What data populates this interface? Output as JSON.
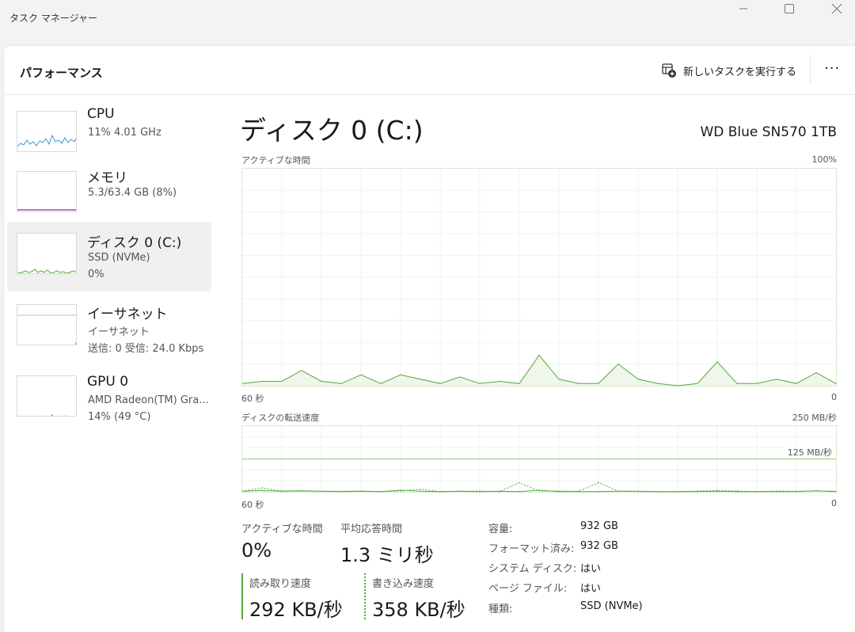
{
  "window": {
    "title": "タスク マネージャー",
    "minimize_glyph": "—",
    "maximize_glyph": "☐",
    "close_glyph": "✕"
  },
  "header": {
    "title": "パフォーマンス",
    "new_task_label": "新しいタスクを実行する",
    "new_task_icon": "new-task-icon",
    "more_label": "···"
  },
  "colors": {
    "cpu": "#3b9bd4",
    "memory": "#a43fb6",
    "disk": "#54a83e",
    "ethernet": "#d0752a",
    "gpu": "#3b9bd4"
  },
  "sidebar": {
    "items": [
      {
        "name": "CPU",
        "line1": "11%  4.01 GHz",
        "line2": ""
      },
      {
        "name": "メモリ",
        "line1": "5.3/63.4 GB (8%)",
        "line2": ""
      },
      {
        "name": "ディスク 0 (C:)",
        "line1": "SSD (NVMe)",
        "line2": "0%"
      },
      {
        "name": "イーサネット",
        "line1": "イーサネット",
        "line2": "送信: 0  受信: 24.0 Kbps"
      },
      {
        "name": "GPU 0",
        "line1": "AMD Radeon(TM) Gra...",
        "line2": "14%  (49 °C)"
      }
    ]
  },
  "main": {
    "title": "ディスク 0 (C:)",
    "model": "WD Blue SN570 1TB",
    "active_graph": {
      "label": "アクティブな時間",
      "max_label": "100%",
      "time_label": "60 秒",
      "min_label": "0"
    },
    "transfer_graph": {
      "label": "ディスクの転送速度",
      "max_label": "250 MB/秒",
      "mid_label": "125 MB/秒",
      "time_label": "60 秒",
      "min_label": "0"
    },
    "stats": {
      "active_time_label": "アクティブな時間",
      "active_time_value": "0%",
      "avg_response_label": "平均応答時間",
      "avg_response_value": "1.3 ミリ秒",
      "read_label": "読み取り速度",
      "read_value": "292 KB/秒",
      "write_label": "書き込み速度",
      "write_value": "358 KB/秒"
    },
    "properties": [
      {
        "key": "容量:",
        "value": "932 GB"
      },
      {
        "key": "フォーマット済み:",
        "value": "932 GB"
      },
      {
        "key": "システム ディスク:",
        "value": "はい"
      },
      {
        "key": "ページ ファイル:",
        "value": "はい"
      },
      {
        "key": "種類:",
        "value": "SSD (NVMe)"
      }
    ]
  },
  "chart_data": [
    {
      "type": "area",
      "title": "アクティブな時間",
      "xlabel": "60 秒",
      "ylim": [
        0,
        100
      ],
      "unit": "%",
      "grid": true,
      "x": [
        60,
        58,
        56,
        54,
        52,
        50,
        48,
        46,
        44,
        42,
        40,
        38,
        36,
        34,
        32,
        30,
        28,
        26,
        24,
        22,
        20,
        18,
        16,
        14,
        12,
        10,
        8,
        6,
        4,
        2,
        0
      ],
      "series": [
        {
          "values": [
            1,
            2,
            2,
            7,
            2,
            1,
            5,
            1,
            5,
            3,
            1,
            4,
            1,
            2,
            1,
            14,
            3,
            1,
            1,
            10,
            3,
            1,
            0,
            1,
            11,
            1,
            1,
            3,
            1,
            6,
            1
          ]
        }
      ]
    },
    {
      "type": "line",
      "title": "ディスクの転送速度",
      "xlabel": "60 秒",
      "ylim": [
        0,
        250
      ],
      "unit": "MB/秒",
      "grid": true,
      "x": [
        60,
        58,
        56,
        54,
        52,
        50,
        48,
        46,
        44,
        42,
        40,
        38,
        36,
        34,
        32,
        30,
        28,
        26,
        24,
        22,
        20,
        18,
        16,
        14,
        12,
        10,
        8,
        6,
        4,
        2,
        0
      ],
      "series": [
        {
          "name": "読み取り速度",
          "style": "solid",
          "values": [
            2,
            5,
            2,
            3,
            2,
            1,
            2,
            1,
            6,
            2,
            1,
            2,
            1,
            2,
            1,
            6,
            1,
            1,
            1,
            2,
            2,
            1,
            1,
            1,
            2,
            1,
            1,
            1,
            1,
            4,
            1
          ]
        },
        {
          "name": "書き込み速度",
          "style": "dashed",
          "values": [
            2,
            15,
            3,
            5,
            2,
            2,
            3,
            1,
            3,
            10,
            1,
            2,
            3,
            1,
            35,
            3,
            3,
            2,
            35,
            3,
            1,
            1,
            1,
            3,
            5,
            3,
            1,
            3,
            2,
            4,
            2
          ]
        }
      ]
    }
  ]
}
